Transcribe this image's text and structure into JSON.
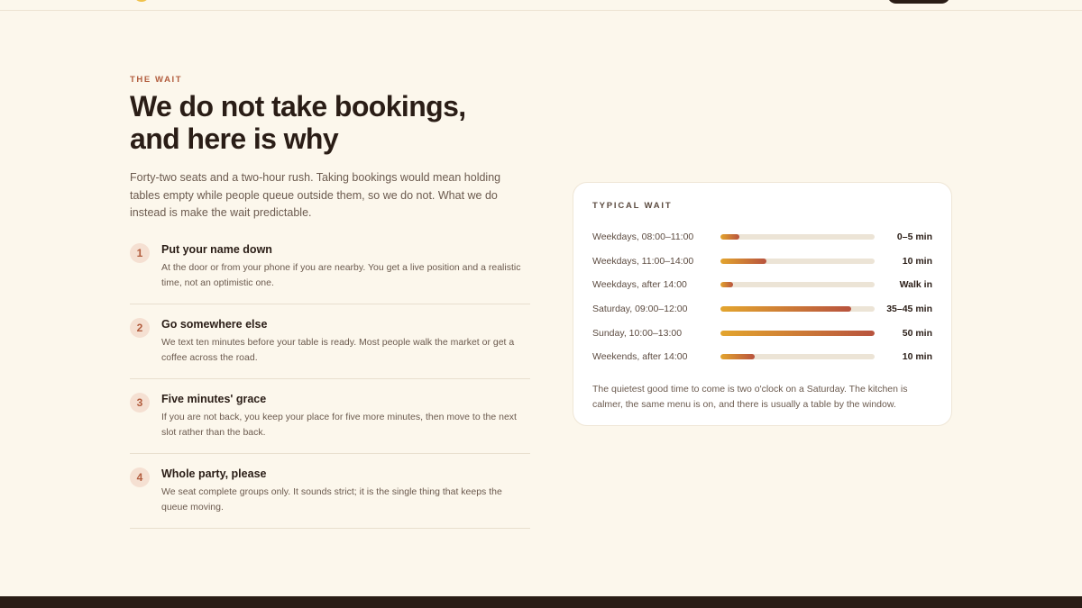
{
  "section": {
    "eyebrow": "THE WAIT",
    "title": "We do not take bookings, and here is why",
    "intro": "Forty-two seats and a two-hour rush. Taking bookings would mean holding tables empty while people queue outside them, so we do not. What we do instead is make the wait predictable."
  },
  "steps": [
    {
      "num": "1",
      "title": "Put your name down",
      "text": "At the door or from your phone if you are nearby. You get a live position and a realistic time, not an optimistic one."
    },
    {
      "num": "2",
      "title": "Go somewhere else",
      "text": "We text ten minutes before your table is ready. Most people walk the market or get a coffee across the road."
    },
    {
      "num": "3",
      "title": "Five minutes' grace",
      "text": "If you are not back, you keep your place for five more minutes, then move to the next slot rather than the back."
    },
    {
      "num": "4",
      "title": "Whole party, please",
      "text": "We seat complete groups only. It sounds strict; it is the single thing that keeps the queue moving."
    }
  ],
  "wait_card": {
    "title": "TYPICAL WAIT",
    "rows": [
      {
        "label": "Weekdays, 08:00–11:00",
        "value": "0–5 min",
        "fill": 0.12
      },
      {
        "label": "Weekdays, 11:00–14:00",
        "value": "10 min",
        "fill": 0.3
      },
      {
        "label": "Weekdays, after 14:00",
        "value": "Walk in",
        "fill": 0.08
      },
      {
        "label": "Saturday, 09:00–12:00",
        "value": "35–45 min",
        "fill": 0.85
      },
      {
        "label": "Sunday, 10:00–13:00",
        "value": "50 min",
        "fill": 1.0
      },
      {
        "label": "Weekends, after 14:00",
        "value": "10 min",
        "fill": 0.22
      }
    ],
    "note": "The quietest good time to come is two o'clock on a Saturday. The kitchen is calmer, the same menu is on, and there is usually a table by the window."
  },
  "colors": {
    "background": "#fcf7ec",
    "accent": "#b25d3e",
    "bar_start": "#e3a52e",
    "bar_end": "#b8533e",
    "ink": "#2a1d16"
  }
}
